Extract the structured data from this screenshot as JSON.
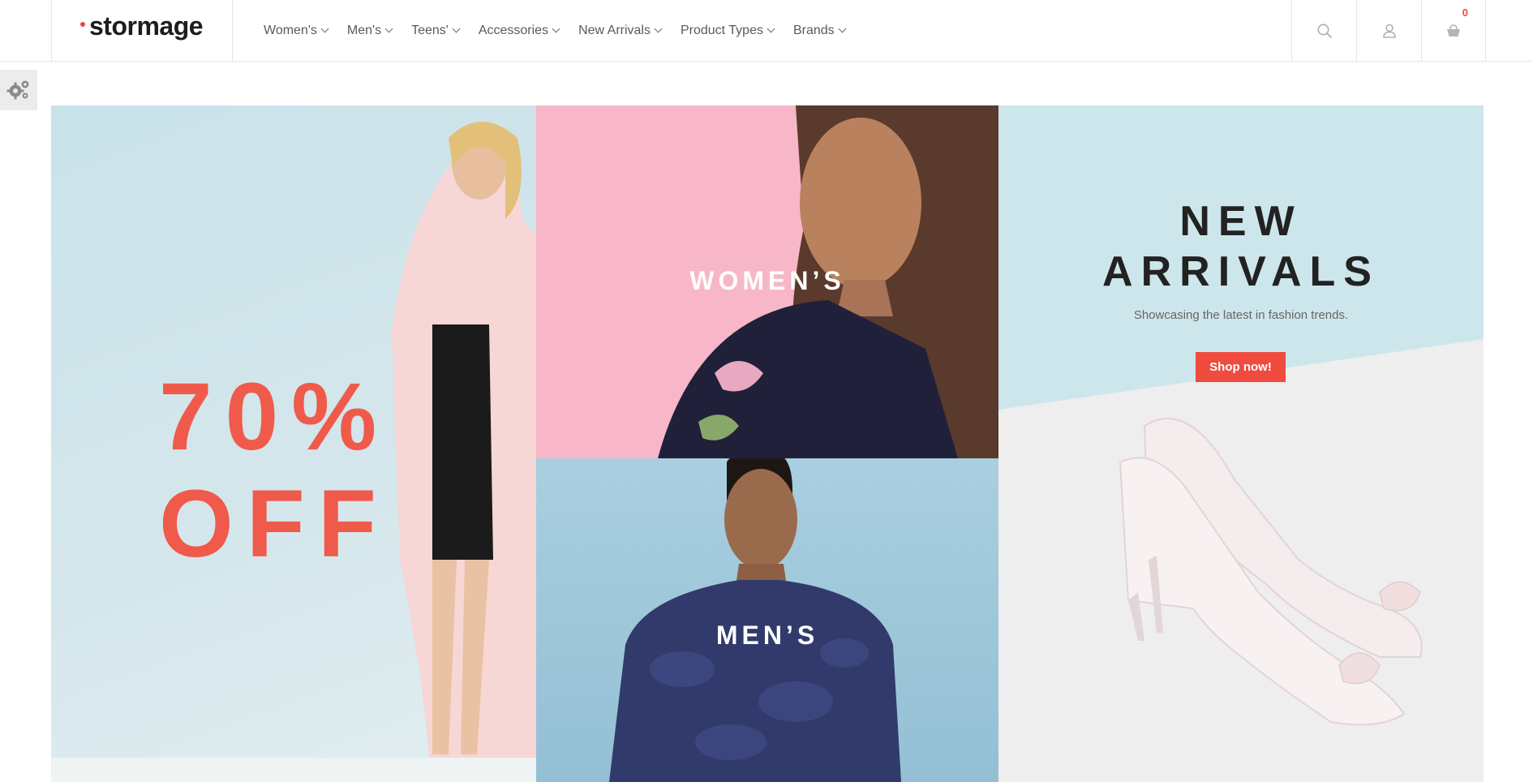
{
  "brand": {
    "logo_text": "stormage",
    "accent_color": "#e94b3c"
  },
  "nav": {
    "items": [
      {
        "label": "Women's"
      },
      {
        "label": "Men's"
      },
      {
        "label": "Teens'"
      },
      {
        "label": "Accessories"
      },
      {
        "label": "New Arrivals"
      },
      {
        "label": "Product Types"
      },
      {
        "label": "Brands"
      }
    ]
  },
  "header_icons": {
    "search": "search-icon",
    "account": "user-icon",
    "cart": "cart-icon",
    "cart_count": "0"
  },
  "settings": {
    "icon": "gears-icon"
  },
  "banners": {
    "sale": {
      "line1": "70%",
      "line2": "OFF",
      "color": "#f05a4a"
    },
    "women": {
      "label": "WOMEN’S"
    },
    "men": {
      "label": "MEN’S"
    },
    "new_arrivals": {
      "line1": "NEW",
      "line2": "ARRIVALS",
      "subtitle": "Showcasing the latest in fashion trends.",
      "button_label": "Shop now!",
      "button_color": "#ef4b3f"
    }
  }
}
